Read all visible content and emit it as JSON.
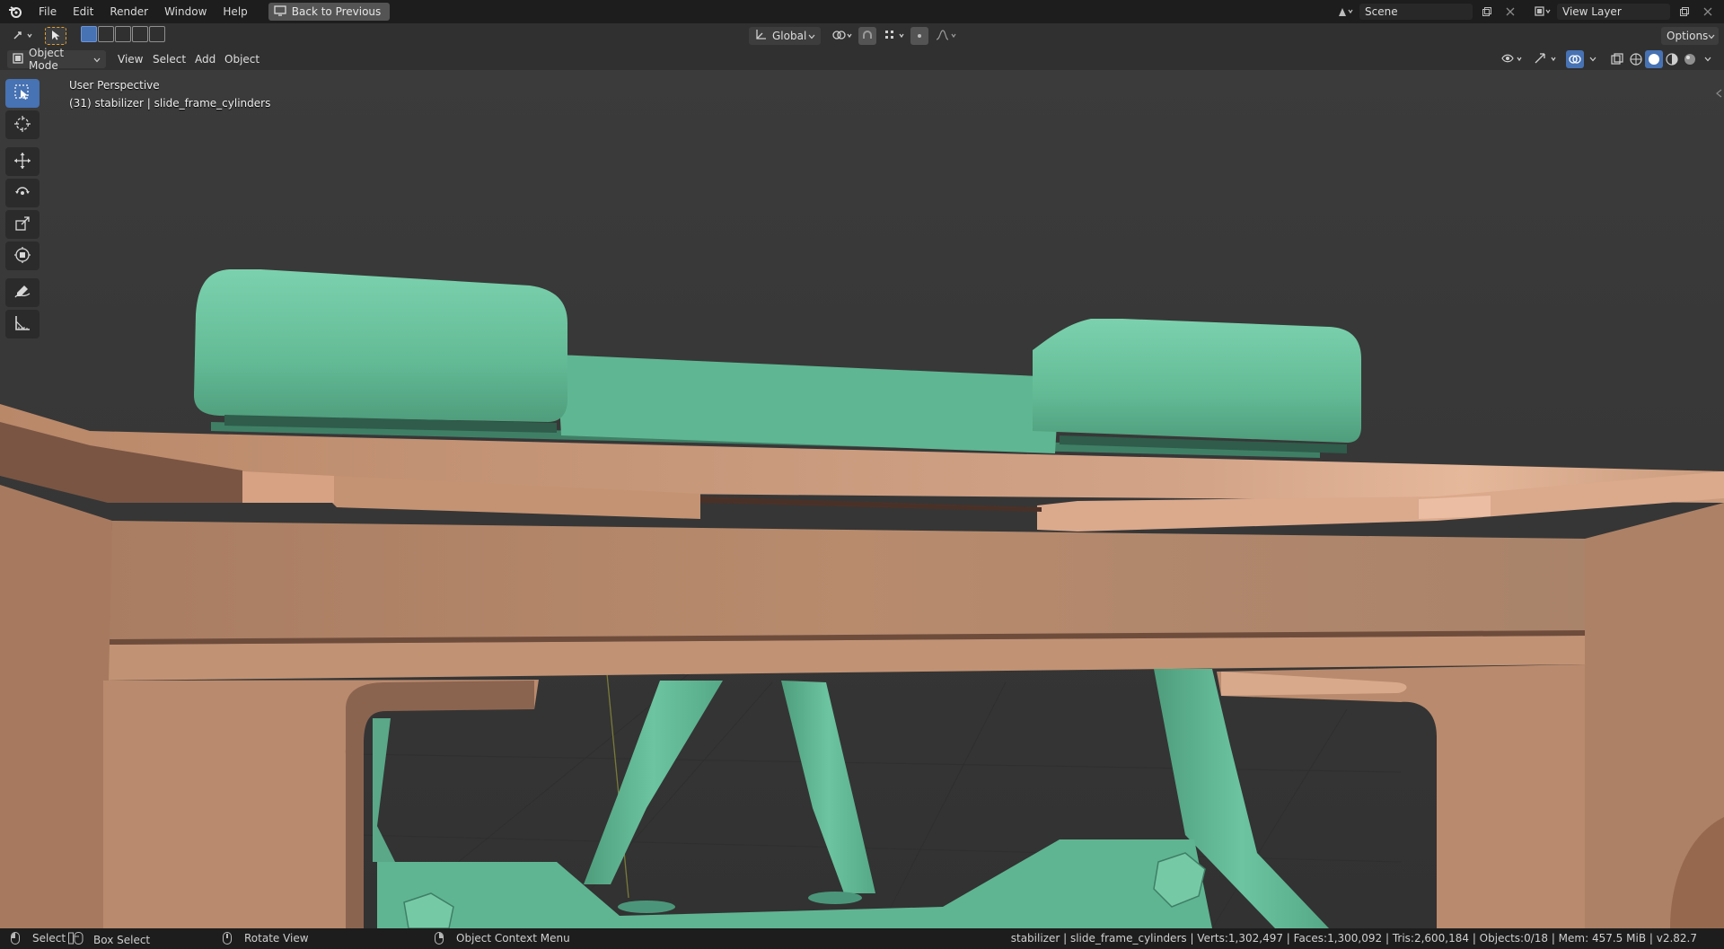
{
  "topbar": {
    "menus": [
      "File",
      "Edit",
      "Render",
      "Window",
      "Help"
    ],
    "back_button": "Back to Previous",
    "scene_name": "Scene",
    "view_layer": "View Layer"
  },
  "tool_header": {
    "orientation": "Global",
    "options_label": "Options"
  },
  "view_header": {
    "mode": "Object Mode",
    "menus": [
      "View",
      "Select",
      "Add",
      "Object"
    ]
  },
  "viewport": {
    "perspective": "User Perspective",
    "active_object": "(31) stabilizer | slide_frame_cylinders"
  },
  "toolbar": {
    "tools": [
      "select-box-icon",
      "cursor-icon",
      "move-icon",
      "rotate-icon",
      "scale-icon",
      "transform-icon",
      "annotate-icon",
      "measure-icon"
    ]
  },
  "statusbar": {
    "select": "Select",
    "box_select": "Box Select",
    "rotate_view": "Rotate View",
    "context_menu": "Object Context Menu",
    "stats": "stabilizer | slide_frame_cylinders | Verts:1,302,497 | Faces:1,300,092 | Tris:2,600,184 | Objects:0/18 | Mem: 457.5 MiB | v2.82.7"
  },
  "colors": {
    "accent": "#4772b3",
    "copper_part": "#c69474",
    "green_part": "#6cc4a0",
    "background": "#3a3a3a"
  }
}
